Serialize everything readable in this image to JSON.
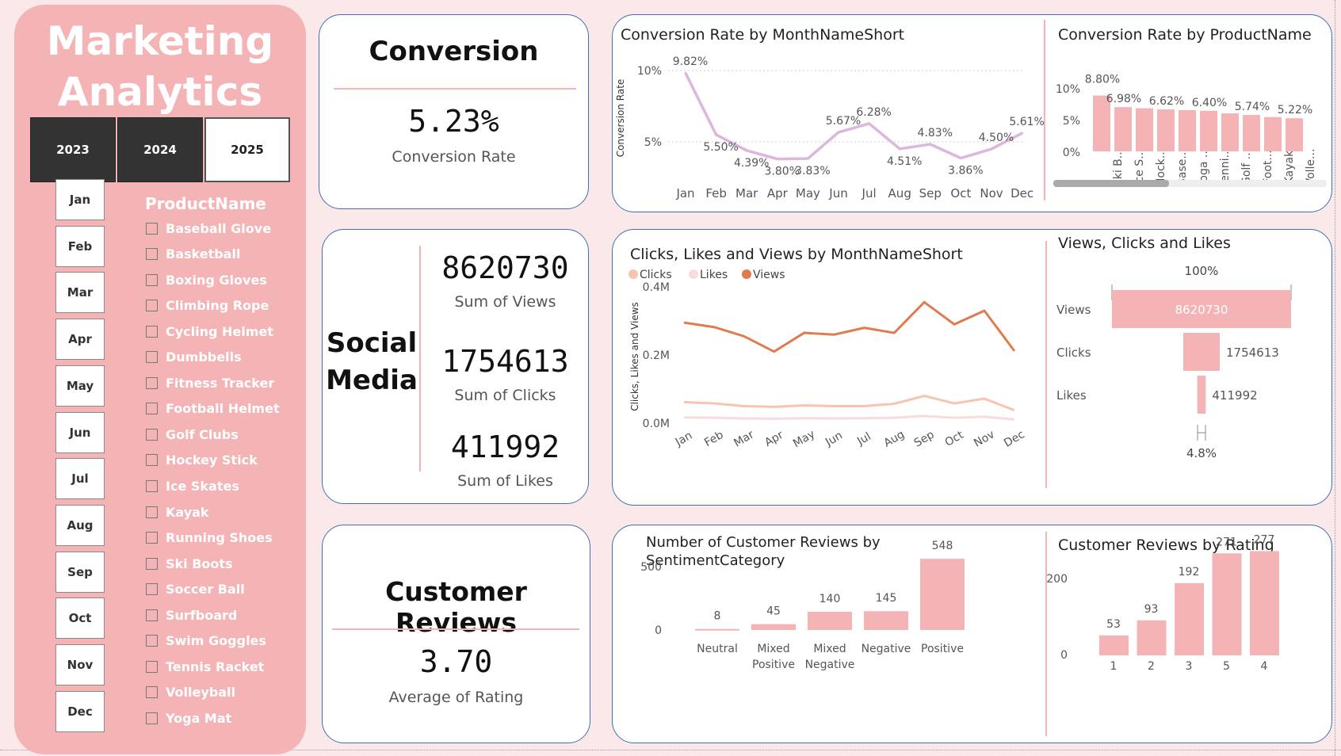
{
  "sidebar": {
    "title_line1": "Marketing",
    "title_line2": "Analytics",
    "years": [
      "2023",
      "2024",
      "2025"
    ],
    "months": [
      "Jan",
      "Feb",
      "Mar",
      "Apr",
      "May",
      "Jun",
      "Jul",
      "Aug",
      "Sep",
      "Oct",
      "Nov",
      "Dec"
    ],
    "product_header": "ProductName",
    "products": [
      "Baseball Glove",
      "Basketball",
      "Boxing Gloves",
      "Climbing Rope",
      "Cycling Helmet",
      "Dumbbells",
      "Fitness Tracker",
      "Football Helmet",
      "Golf Clubs",
      "Hockey Stick",
      "Ice Skates",
      "Kayak",
      "Running Shoes",
      "Ski Boots",
      "Soccer Ball",
      "Surfboard",
      "Swim Goggles",
      "Tennis Racket",
      "Volleyball",
      "Yoga Mat"
    ]
  },
  "conversion_card": {
    "title": "Conversion",
    "value": "5.23%",
    "label": "Conversion Rate"
  },
  "social_card": {
    "title_line1": "Social",
    "title_line2": "Media",
    "views": "8620730",
    "views_label": "Sum of Views",
    "clicks": "1754613",
    "clicks_label": "Sum of Clicks",
    "likes": "411992",
    "likes_label": "Sum of Likes"
  },
  "reviews_card": {
    "title": "Customer Reviews",
    "value": "3.70",
    "label": "Average of Rating"
  },
  "colors": {
    "pink": "#f4b3b4",
    "pink_line": "#dcb6dc",
    "dark": "#333333",
    "views": "#e07b4f",
    "clicks": "#f7c4ae",
    "likes": "#fadadd",
    "card_border": "#3e6fb5"
  },
  "chart_data": [
    {
      "id": "conv_month",
      "type": "line",
      "title": "Conversion Rate by MonthNameShort",
      "ylabel": "Conversion Rate",
      "yticks": [
        "10%",
        "5%"
      ],
      "ylim": [
        0.03,
        0.105
      ],
      "x": [
        "Jan",
        "Feb",
        "Mar",
        "Apr",
        "May",
        "Jun",
        "Jul",
        "Aug",
        "Sep",
        "Oct",
        "Nov",
        "Dec"
      ],
      "values": [
        0.0982,
        0.055,
        0.0439,
        0.038,
        0.0383,
        0.0567,
        0.0628,
        0.0451,
        0.0483,
        0.0386,
        0.045,
        0.0561
      ],
      "labels": [
        "9.82%",
        "5.50%",
        "4.39%",
        "3.80%",
        "3.83%",
        "5.67%",
        "6.28%",
        "4.51%",
        "4.83%",
        "3.86%",
        "4.50%",
        "5.61%"
      ]
    },
    {
      "id": "conv_product",
      "type": "bar",
      "title": "Conversion Rate by ProductName",
      "yticks": [
        "10%",
        "5%",
        "0%"
      ],
      "ylim": [
        0,
        0.1
      ],
      "categories": [
        "Ski B...",
        "Ice S...",
        "Hock...",
        "Base...",
        "Yoga ...",
        "Tenni...",
        "Golf ...",
        "Foot...",
        "Kayak",
        "Volle..."
      ],
      "values": [
        0.088,
        0.0698,
        0.068,
        0.0662,
        0.065,
        0.064,
        0.06,
        0.0574,
        0.054,
        0.0522
      ],
      "labels": [
        "8.80%",
        "6.98%",
        "",
        "6.62%",
        "",
        "6.40%",
        "",
        "5.74%",
        "",
        "5.22%"
      ]
    },
    {
      "id": "clv_month",
      "type": "line",
      "title": "Clicks, Likes and Views by MonthNameShort",
      "ylabel": "Clicks, Likes and Views",
      "yticks": [
        "0.4M",
        "0.2M",
        "0.0M"
      ],
      "ylim": [
        0,
        400000
      ],
      "x": [
        "Jan",
        "Feb",
        "Mar",
        "Apr",
        "May",
        "Jun",
        "Jul",
        "Aug",
        "Sep",
        "Oct",
        "Nov",
        "Dec"
      ],
      "legend": [
        "Clicks",
        "Likes",
        "Views"
      ],
      "series": [
        {
          "name": "Clicks",
          "values": [
            62000,
            58000,
            50000,
            48000,
            52000,
            50000,
            50000,
            57000,
            80000,
            58000,
            72000,
            38000
          ]
        },
        {
          "name": "Likes",
          "values": [
            17000,
            16000,
            14000,
            13000,
            14500,
            14000,
            14500,
            16000,
            21000,
            16000,
            19000,
            11000
          ]
        },
        {
          "name": "Views",
          "values": [
            295000,
            282000,
            255000,
            210000,
            265000,
            260000,
            280000,
            265000,
            355000,
            290000,
            330000,
            212000
          ]
        }
      ]
    },
    {
      "id": "funnel",
      "type": "bar",
      "title": "Views, Clicks and Likes",
      "top_label": "100%",
      "bottom_label": "4.8%",
      "categories": [
        "Views",
        "Clicks",
        "Likes"
      ],
      "values": [
        8620730,
        1754613,
        411992
      ],
      "labels": [
        "8620730",
        "1754613",
        "411992"
      ]
    },
    {
      "id": "sentiment",
      "type": "bar",
      "title_line1": "Number of Customer Reviews by",
      "title_line2": "SentimentCategory",
      "yticks": [
        "500",
        "0"
      ],
      "ylim": [
        0,
        600
      ],
      "categories": [
        [
          "Neutral"
        ],
        [
          "Mixed",
          "Positive"
        ],
        [
          "Mixed",
          "Negative"
        ],
        [
          "Negative"
        ],
        [
          "Positive"
        ]
      ],
      "values": [
        8,
        45,
        140,
        145,
        548
      ],
      "labels": [
        "8",
        "45",
        "140",
        "145",
        "548"
      ]
    },
    {
      "id": "rating",
      "type": "bar",
      "title": "Customer Reviews by Rating",
      "yticks": [
        "200",
        "0"
      ],
      "ylim": [
        0,
        300
      ],
      "categories": [
        "1",
        "2",
        "3",
        "5",
        "4"
      ],
      "values": [
        53,
        93,
        192,
        271,
        277
      ],
      "labels": [
        "53",
        "93",
        "192",
        "271",
        "277"
      ]
    }
  ]
}
